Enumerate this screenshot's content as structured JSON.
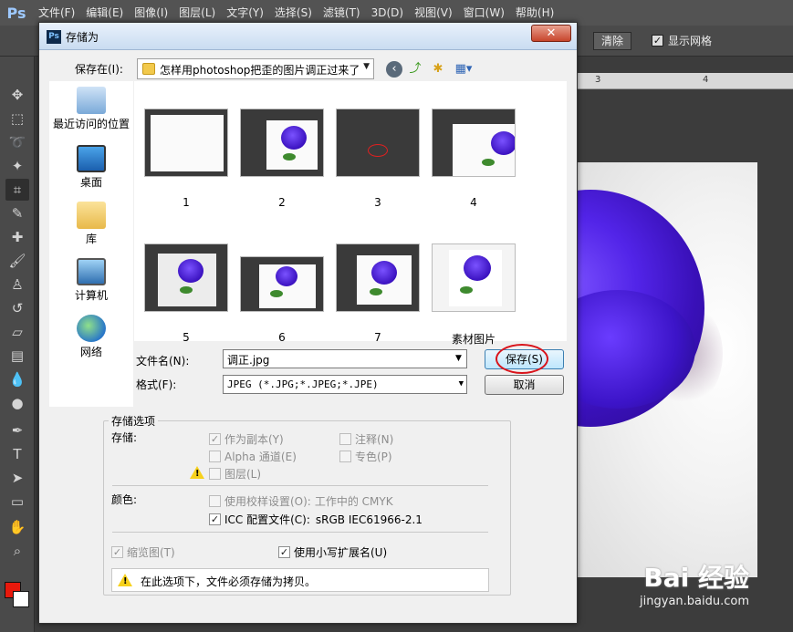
{
  "app": {
    "logo": "Ps",
    "menu": [
      "文件(F)",
      "编辑(E)",
      "图像(I)",
      "图层(L)",
      "文字(Y)",
      "选择(S)",
      "滤镜(T)",
      "3D(D)",
      "视图(V)",
      "窗口(W)",
      "帮助(H)"
    ],
    "options": {
      "clear_label": "清除",
      "show_grid_label": "显示网格",
      "show_grid_checked": true
    },
    "ruler_ticks": [
      "3",
      "4"
    ],
    "fg_color": "#e8190c",
    "bg_color": "#ffffff",
    "watermark": {
      "logo": "Bai 经验",
      "url": "jingyan.baidu.com"
    }
  },
  "dialog": {
    "title": "存储为",
    "close_glyph": "✕",
    "save_in_label": "保存在(I):",
    "save_in_value": "怎样用photoshop把歪的图片调正过来了",
    "places": [
      {
        "label": "最近访问的位置",
        "icon": "recent-places-icon"
      },
      {
        "label": "桌面",
        "icon": "desktop-icon"
      },
      {
        "label": "库",
        "icon": "libraries-icon"
      },
      {
        "label": "计算机",
        "icon": "computer-icon"
      },
      {
        "label": "网络",
        "icon": "network-icon"
      }
    ],
    "files": [
      "1",
      "2",
      "3",
      "4",
      "5",
      "6",
      "7",
      "素材图片"
    ],
    "filename_label": "文件名(N):",
    "filename_value": "调正.jpg",
    "format_label": "格式(F):",
    "format_value": "JPEG (*.JPG;*.JPEG;*.JPE)",
    "save_button": "保存(S)",
    "cancel_button": "取消",
    "options_group_title": "存储选项",
    "save_section_label": "存储:",
    "checkboxes": {
      "as_copy": {
        "label": "作为副本(Y)",
        "checked": true
      },
      "notes": {
        "label": "注释(N)",
        "checked": false
      },
      "alpha": {
        "label": "Alpha 通道(E)",
        "checked": false
      },
      "spot": {
        "label": "专色(P)",
        "checked": false
      },
      "layers": {
        "label": "图层(L)",
        "checked": false
      }
    },
    "color_section_label": "颜色:",
    "proof": {
      "label": "使用校样设置(O):",
      "value": "工作中的 CMYK",
      "checked": false
    },
    "icc": {
      "label": "ICC 配置文件(C):",
      "value": "sRGB IEC61966-2.1",
      "checked": true
    },
    "thumbnail": {
      "label": "缩览图(T)",
      "checked": true
    },
    "lowercase_ext": {
      "label": "使用小写扩展名(U)",
      "checked": true
    },
    "warning_text": "在此选项下，文件必须存储为拷贝。"
  }
}
